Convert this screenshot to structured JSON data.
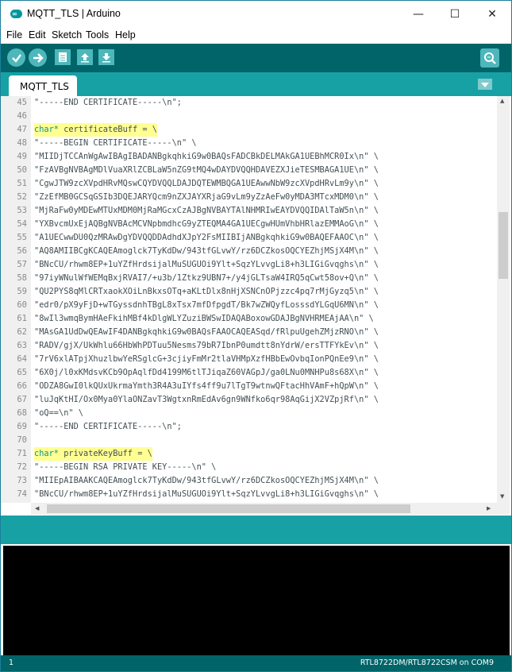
{
  "window": {
    "title": "MQTT_TLS | Arduino",
    "app_icon_text": "∞"
  },
  "controls": {
    "minimize": "—",
    "maximize": "☐",
    "close": "✕"
  },
  "menu": [
    "File",
    "Edit",
    "Sketch",
    "Tools",
    "Help"
  ],
  "toolbar": [
    "verify-icon",
    "upload-icon",
    "new-icon",
    "open-icon",
    "save-icon",
    "serial-monitor-icon"
  ],
  "tabs": [
    {
      "label": "MQTT_TLS"
    }
  ],
  "colors": {
    "accent": "#00979c",
    "toolbar": "#006468",
    "tabbar": "#17a1a5",
    "highlight": "#ffff92"
  },
  "editor": {
    "lines": [
      {
        "n": "45",
        "text": "\"-----END CERTIFICATE-----\\n\";"
      },
      {
        "n": "46",
        "text": ""
      },
      {
        "n": "47",
        "kw": "char*",
        "text": " certificateBuff = \\",
        "hl": true
      },
      {
        "n": "48",
        "text": "\"-----BEGIN CERTIFICATE-----\\n\" \\"
      },
      {
        "n": "49",
        "text": "\"MIIDjTCCAnWgAwIBAgIBADANBgkqhkiG9w0BAQsFADCBkDELMAkGA1UEBhMCR0Ix\\n\" \\"
      },
      {
        "n": "50",
        "text": "\"FzAVBgNVBAgMDlVuaXRlZCBLaW5nZG9tMQ4wDAYDVQQHDAVEZXJieTESMBAGA1UE\\n\" \\"
      },
      {
        "n": "51",
        "text": "\"CgwJTW9zcXVpdHRvMQswCQYDVQQLDAJDQTEWMBQGA1UEAwwNbW9zcXVpdHRvLm9y\\n\" \\"
      },
      {
        "n": "52",
        "text": "\"ZzEfMB0GCSqGSIb3DQEJARYQcm9nZXJAYXRjaG9vLm9yZzAeFw0yMDA3MTcxMDM0\\n\" \\"
      },
      {
        "n": "53",
        "text": "\"MjRaFw0yMDEwMTUxMDM0MjRaMGcxCzAJBgNVBAYTAlNHMRIwEAYDVQQIDAlTaW5n\\n\" \\"
      },
      {
        "n": "54",
        "text": "\"YXBvcmUxEjAQBgNVBAcMCVNpbmdhcG9yZTEQMA4GA1UECgwHUmVhbHRlazEMMAoG\\n\" \\"
      },
      {
        "n": "55",
        "text": "\"A1UECwwDU0QzMRAwDgYDVQQDDAdhdXJpY2FsMIIBIjANBgkqhkiG9w0BAQEFAAOC\\n\" \\"
      },
      {
        "n": "56",
        "text": "\"AQ8AMIIBCgKCAQEAmoglck7TyKdDw/943tfGLvwY/rz6DCZkosOQCYEZhjMSjX4M\\n\" \\"
      },
      {
        "n": "57",
        "text": "\"BNcCU/rhwm8EP+1uYZfHrdsijalMuSUGUOi9Ylt+SqzYLvvgLi8+h3LIGiGvqghs\\n\" \\"
      },
      {
        "n": "58",
        "text": "\"97iyWNulWfWEMqBxjRVAI7/+u3b/1Ztkz9UBN7+/y4jGLTsaW4IRQ5qCwt58ov+Q\\n\" \\"
      },
      {
        "n": "59",
        "text": "\"QU2PYS8qMlCRTxaokXOiLnBkxsOTq+aKLtDlx8nHjXSNCnOPjzzc4pq7rMjGyzq5\\n\" \\"
      },
      {
        "n": "60",
        "text": "\"edr0/pX9yFjD+wTGyssdnhTBgL8xTsx7mfDfpgdT/Bk7wZWQyfLosssdYLGqU6MN\\n\" \\"
      },
      {
        "n": "61",
        "text": "\"8wIl3wmqBymHAeFkihMBf4kDlgWLYZuziBWSwIDAQABoxowGDAJBgNVHRMEAjAA\\n\" \\"
      },
      {
        "n": "62",
        "text": "\"MAsGA1UdDwQEAwIF4DANBgkqhkiG9w0BAQsFAAOCAQEASqd/fRlpuUgehZMjzRNO\\n\" \\"
      },
      {
        "n": "63",
        "text": "\"RADV/gjX/UkWhlu66HbWhPDTuu5Nesms79bR7IbnP0umdtt8nYdrW/ersTTFYkEv\\n\" \\"
      },
      {
        "n": "64",
        "text": "\"7rV6xlATpjXhuzlbwYeRSglcG+3cjiyFmMr2tlaVHMpXzfHBbEwOvbqIonPQnEe9\\n\" \\"
      },
      {
        "n": "65",
        "text": "\"6X0j/l0xKMdsvKCb9OpAqlfDd4199M6tlTJiqaZ60VAGpJ/ga0LNu0MNHPu8s68X\\n\" \\"
      },
      {
        "n": "66",
        "text": "\"ODZA8GwI0lkQUxUkrmaYmth3R4A3uIYfs4ff9u7lTgT9wtnwQFtacHhVAmF+hQpW\\n\" \\"
      },
      {
        "n": "67",
        "text": "\"luJqKtHI/Ox0Mya0YlaONZavT3WgtxnRmEdAv6gn9WNfko6qr98AqGijX2VZpjRf\\n\" \\"
      },
      {
        "n": "68",
        "text": "\"oQ==\\n\" \\"
      },
      {
        "n": "69",
        "text": "\"-----END CERTIFICATE-----\\n\";"
      },
      {
        "n": "70",
        "text": ""
      },
      {
        "n": "71",
        "kw": "char*",
        "text": " privateKeyBuff = \\",
        "hl": true
      },
      {
        "n": "72",
        "text": "\"-----BEGIN RSA PRIVATE KEY-----\\n\" \\"
      },
      {
        "n": "73",
        "text": "\"MIIEpAIBAAKCAQEAmoglck7TyKdDw/943tfGLvwY/rz6DCZkosOQCYEZhjMSjX4M\\n\" \\"
      },
      {
        "n": "74",
        "text": "\"BNcCU/rhwm8EP+1uYZfHrdsijalMuSUGUOi9Ylt+SqzYLvvgLi8+h3LIGiGvqghs\\n\" \\"
      }
    ]
  },
  "footer": {
    "line_number": "1",
    "board": "RTL8722DM/RTL8722CSM on COM9"
  }
}
